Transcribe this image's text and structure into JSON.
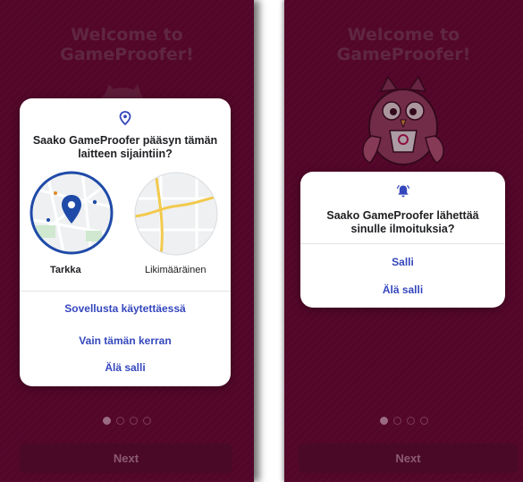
{
  "left_screen": {
    "welcome_title_line1": "Welcome to",
    "welcome_title_line2": "GameProofer!",
    "dialog": {
      "title": "Saako GameProofer pääsyn tämän laitteen sijaintiin?",
      "option_precise": "Tarkka",
      "option_approximate": "Likimääräinen",
      "actions": [
        "Sovellusta käytettäessä",
        "Vain tämän kerran",
        "Älä salli"
      ]
    },
    "page_indicator": {
      "current": 1,
      "total": 4
    },
    "next_label": "Next"
  },
  "right_screen": {
    "welcome_title_line1": "Welcome to",
    "welcome_title_line2": "GameProofer!",
    "dialog": {
      "title": "Saako GameProofer lähettää sinulle ilmoituksia?",
      "actions": [
        "Salli",
        "Älä salli"
      ]
    },
    "page_indicator": {
      "current": 1,
      "total": 4
    },
    "next_label": "Next"
  },
  "colors": {
    "background": "#6b0a36",
    "dialog": "#ffffff",
    "accent_blue": "#3547bd",
    "map_ring": "#1f4aa8"
  },
  "icons": [
    "location-pin-icon",
    "notification-bell-icon",
    "mascot-owl-icon"
  ]
}
